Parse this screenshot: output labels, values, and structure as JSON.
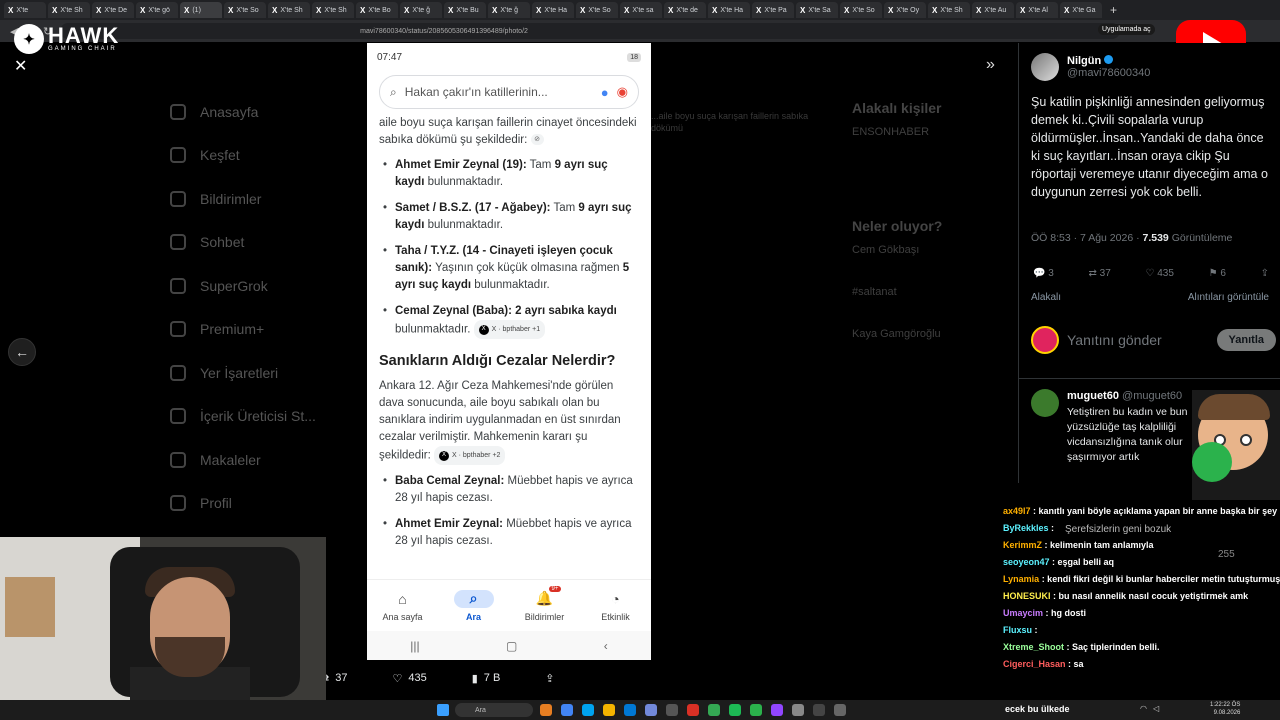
{
  "browser": {
    "tabs": [
      "X'te",
      "X'te Sh",
      "X'te De",
      "X'te gö",
      "(1)",
      "X'te So",
      "X'te Sh",
      "X'te Sh",
      "X'te Bo",
      "X'te ğ",
      "X'te Bu",
      "X'te ğ",
      "X'te Ha",
      "X'te So",
      "X'te sa",
      "X'te de",
      "X'te Ha",
      "X'te Pa",
      "X'te Sa",
      "X'te So",
      "X'te Oy",
      "X'te Sh",
      "X'te Au",
      "X'te Al",
      "X'te Ga"
    ],
    "url": "mavi78600340/status/2085605306491396489/photo/2",
    "open_in_app": "Uygulamada aç"
  },
  "overlay": {
    "brand": "HAWK",
    "brand_sub": "GAMING CHAIR"
  },
  "x_sidebar_dim": [
    "Anasayfa",
    "Keşfet",
    "Bildirimler",
    "Sohbet",
    "SuperGrok",
    "Premium+",
    "Yer İşaretleri",
    "İçerik Üreticisi St...",
    "Makaleler",
    "Profil"
  ],
  "x_mid_dim": "...aile boyu suça karışan faillerin sabıka dökümü",
  "x_right_dim": {
    "related_title": "Alakalı kişiler",
    "related_user": "ENSONHABER",
    "trending_title": "Neler oluyor?",
    "trend1": "Cem Gökbaşı",
    "trend2": "#saltanat",
    "trend3": "Kaya Gamgöroğlu"
  },
  "phone": {
    "time": "07:47",
    "battery": "18",
    "search_query": "Hakan çakır'ın katillerinin...",
    "intro": "aile boyu suça karışan faillerin cinayet öncesindeki sabıka dökümü şu şekildedir:",
    "items": [
      {
        "bold": "Ahmet Emir Zeynal (19):",
        "text": " Tam ",
        "bold2": "9 ayrı suç kaydı",
        "text2": " bulunmaktadır."
      },
      {
        "bold": "Samet / B.S.Z. (17 - Ağabey):",
        "text": " Tam ",
        "bold2": "9 ayrı suç kaydı",
        "text2": " bulunmaktadır."
      },
      {
        "bold": "Taha / T.Y.Z. (14 - Cinayeti işleyen çocuk sanık):",
        "text": " Yaşının çok küçük olmasına rağmen ",
        "bold2": "5 ayrı suç kaydı",
        "text2": " bulunmaktadır."
      },
      {
        "bold": "Cemal Zeynal (Baba):",
        "text": " ",
        "bold2": "2 ayrı sabıka kaydı",
        "text2": " bulunmaktadır."
      }
    ],
    "chip1": "X · bpthaber +1",
    "heading": "Sanıkların Aldığı Cezalar Nelerdir?",
    "paragraph": "Ankara 12. Ağır Ceza Mahkemesi'nde görülen dava sonucunda, aile boyu sabıkalı olan bu sanıklara indirim uygulanmadan en üst sınırdan cezalar verilmiştir. Mahkemenin kararı şu şekildedir:",
    "chip2": "X · bpthaber +2",
    "sentences": [
      {
        "bold": "Baba Cemal Zeynal:",
        "text": " Müebbet hapis ve ayrıca 28 yıl hapis cezası."
      },
      {
        "bold": "Ahmet Emir Zeynal:",
        "text": " Müebbet hapis ve ayrıca 28 yıl hapis cezası."
      }
    ],
    "nav": [
      {
        "label": "Ana sayfa",
        "icon": "home-icon"
      },
      {
        "label": "Ara",
        "icon": "search-icon"
      },
      {
        "label": "Bildirimler",
        "icon": "bell-icon",
        "badge": "9+"
      },
      {
        "label": "Etkinlik",
        "icon": "activity-icon"
      }
    ]
  },
  "photo_stats": {
    "retweets": "37",
    "likes": "435",
    "views": "7 B"
  },
  "tweet": {
    "name": "Nilgün",
    "handle": "@mavi78600340",
    "text": "Şu katilin pişkinliği annesinden geliyormuş demek ki..Çivili sopalarla vurup öldürmüşler..İnsan..Yandaki de daha önce ki suç kayıtları..İnsan oraya cikip Şu röportaji veremeye utanır diyeceğim ama o duygunun zerresi yok cok belli.",
    "time": "ÖÖ 8:53 · 7 Ağu 2026 · ",
    "views": "7.539",
    "views_label": " Görüntüleme",
    "replies": "3",
    "retweets": "37",
    "likes": "435",
    "bookmarks": "6",
    "related": "Alakalı",
    "quotes": "Alıntıları görüntüle",
    "reply_placeholder": "Yanıtını gönder",
    "reply_button": "Yanıtla"
  },
  "reply": {
    "name": "muguet60",
    "handle": "@muguet60",
    "text": "Yetiştiren bu kadın ve bun yüzsüzlüğe taş kalpliliği vicdansızlığına tanık olur şaşırmıyor artık"
  },
  "ghost_reply": "Şerefsizlerin geni bozuk",
  "ghost_views": "255",
  "chat": [
    {
      "user": "ax49l7",
      "msg": "kanıtlı yani böyle açıklama yapan bir anne başka bir şey olamaz",
      "cls": "u1"
    },
    {
      "user": "ByRekkles",
      "msg": "",
      "cls": "u2"
    },
    {
      "user": "KerimmZ",
      "msg": "kelimenin tam anlamıyla",
      "cls": "u1"
    },
    {
      "user": "seoyeon47",
      "msg": "eşgal belli aq",
      "cls": "u2"
    },
    {
      "user": "Lynamia",
      "msg": "kendi fikri değil ki bunlar haberciler metin tutuşturmuş ellerine",
      "cls": "u1"
    },
    {
      "user": "HONESUKI",
      "msg": "bu nasıl annelik nasıl cocuk yetiştirmek amk",
      "cls": "u5"
    },
    {
      "user": "Umaycim",
      "msg": "hg dosti",
      "cls": "u6"
    },
    {
      "user": "Fluxsu",
      "msg": "",
      "cls": "u2"
    },
    {
      "user": "Xtreme_Shoot",
      "msg": "Saç tiplerinden belli.",
      "cls": "u4"
    },
    {
      "user": "Cigerci_Hasan",
      "msg": "sa",
      "cls": "u3"
    }
  ],
  "chat_bottom": "ecek bu ülkede",
  "taskbar": {
    "search": "Ara",
    "time": "1:22:22 ÖS",
    "date": "9.08.2026"
  },
  "colors": {
    "youtube": "#ff0000",
    "x_blue": "#1d9bf0",
    "google_blue": "#0b57d0"
  }
}
